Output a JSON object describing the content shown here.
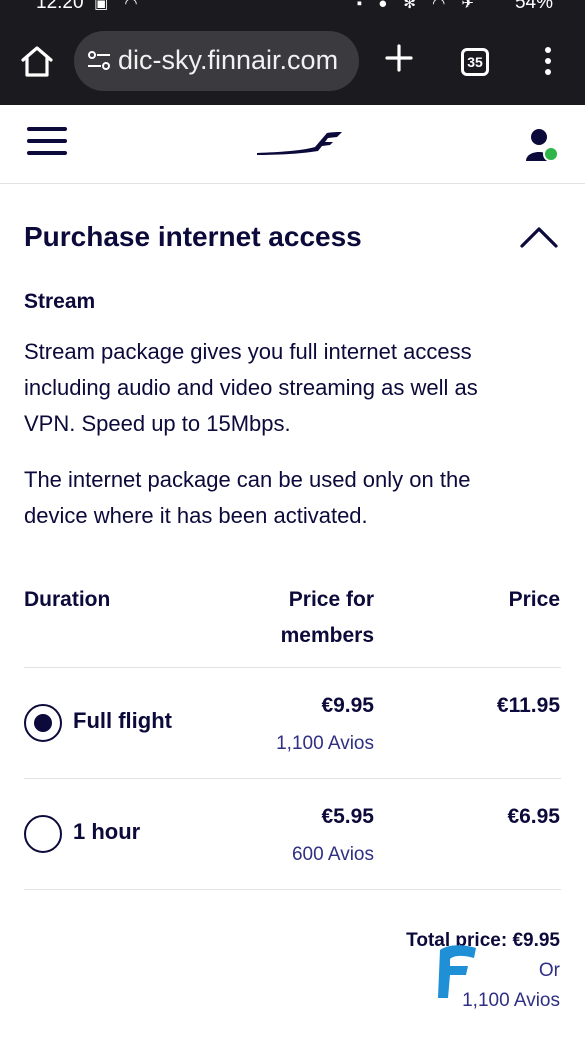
{
  "status_bar": {
    "time": "12:20",
    "battery": "54%"
  },
  "browser": {
    "url": "dic-sky.finnair.com",
    "tab_count": "35"
  },
  "section": {
    "title": "Purchase internet access",
    "package_name": "Stream",
    "description": "Stream package gives you full internet access including audio and video streaming as well as VPN. Speed up to 15Mbps.",
    "note": "The internet package can be used only on the device where it has been activated."
  },
  "table": {
    "headers": {
      "duration": "Duration",
      "members_price": "Price for members",
      "price": "Price"
    },
    "rows": [
      {
        "label": "Full flight",
        "member_price": "€9.95",
        "avios": "1,100 Avios",
        "price": "€11.95",
        "selected": true
      },
      {
        "label": "1 hour",
        "member_price": "€5.95",
        "avios": "600 Avios",
        "price": "€6.95",
        "selected": false
      }
    ]
  },
  "total": {
    "label": "Total price: €9.95",
    "or": "Or",
    "avios": "1,100 Avios"
  },
  "colors": {
    "brand_navy": "#0b0a3a",
    "avios_blue": "#2f2f84",
    "status_green": "#2fb54a",
    "badge_blue": "#1f8fd6"
  }
}
